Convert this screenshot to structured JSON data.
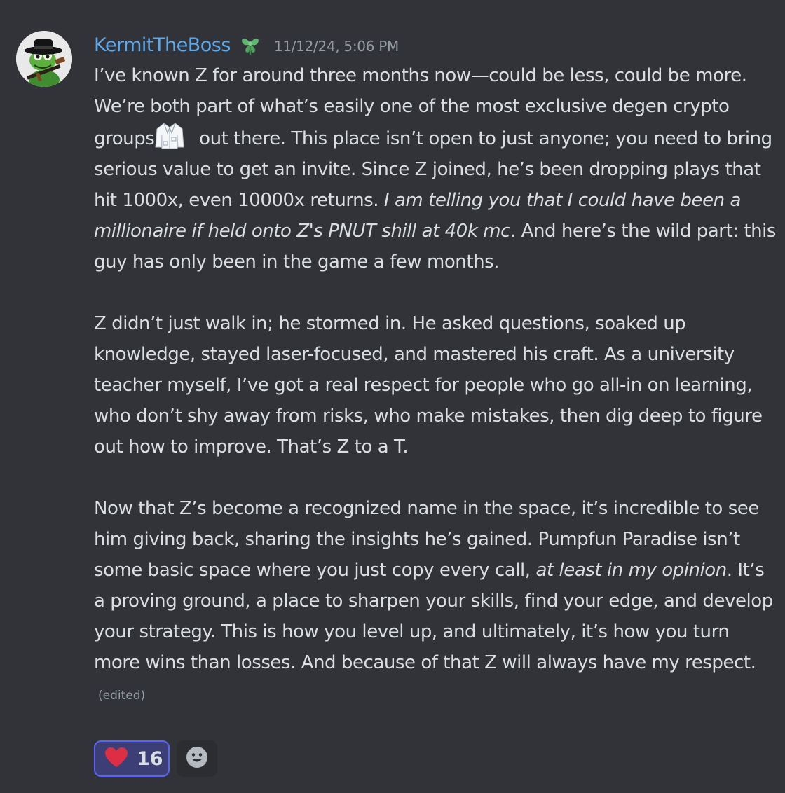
{
  "message": {
    "author": "KermitTheBoss",
    "role_icon": "green-flower-role-icon",
    "timestamp": "11/12/24, 5:06 PM",
    "paragraph1": {
      "part1": "I’ve known Z for around three months now—could be less, could be more. We’re both part of what’s easily one of the most exclusive degen crypto groups",
      "emoji": "lab-coat-icon",
      "part2": " out there. This place isn’t open to just anyone; you need to bring serious value to get an invite. Since Z joined, he’s been dropping plays that hit 1000x, even 10000x returns. ",
      "italic": "I am telling you that I could have been a millionaire if held onto Z's PNUT shill at 40k mc",
      "part3": ". And here’s the wild part: this guy has only been in the game a few months."
    },
    "paragraph2": "Z didn’t just walk in; he stormed in. He asked questions, soaked up knowledge, stayed laser-focused, and mastered his craft. As a university teacher myself, I’ve got a real respect for people who go all-in on learning, who don’t shy away from risks, who make mistakes, then dig deep to figure out how to improve. That’s Z to a T.",
    "paragraph3": {
      "part1": "Now that Z’s become a recognized name in the space, it’s incredible to see him giving back, sharing the insights he’s gained. Pumpfun Paradise isn’t some basic space where you just copy every call, ",
      "italic": "at least in my opinion",
      "part2": ". It’s a proving ground, a place to sharpen your skills, find your edge, and develop your strategy. This is how you level up, and ultimately, it’s how you turn more wins than losses. And because of that Z will always have my respect."
    },
    "edited_label": "(edited)"
  },
  "reactions": [
    {
      "emoji": "red-heart-icon",
      "count": "16",
      "selected": true
    }
  ],
  "add_reaction_icon": "smiley-face-icon",
  "colors": {
    "background": "#313338",
    "username": "#5ea9ea",
    "text": "#dbdee1",
    "muted": "#949ba4",
    "reaction_selected_bg": "#3b3f75",
    "reaction_selected_border": "#5865f2"
  }
}
